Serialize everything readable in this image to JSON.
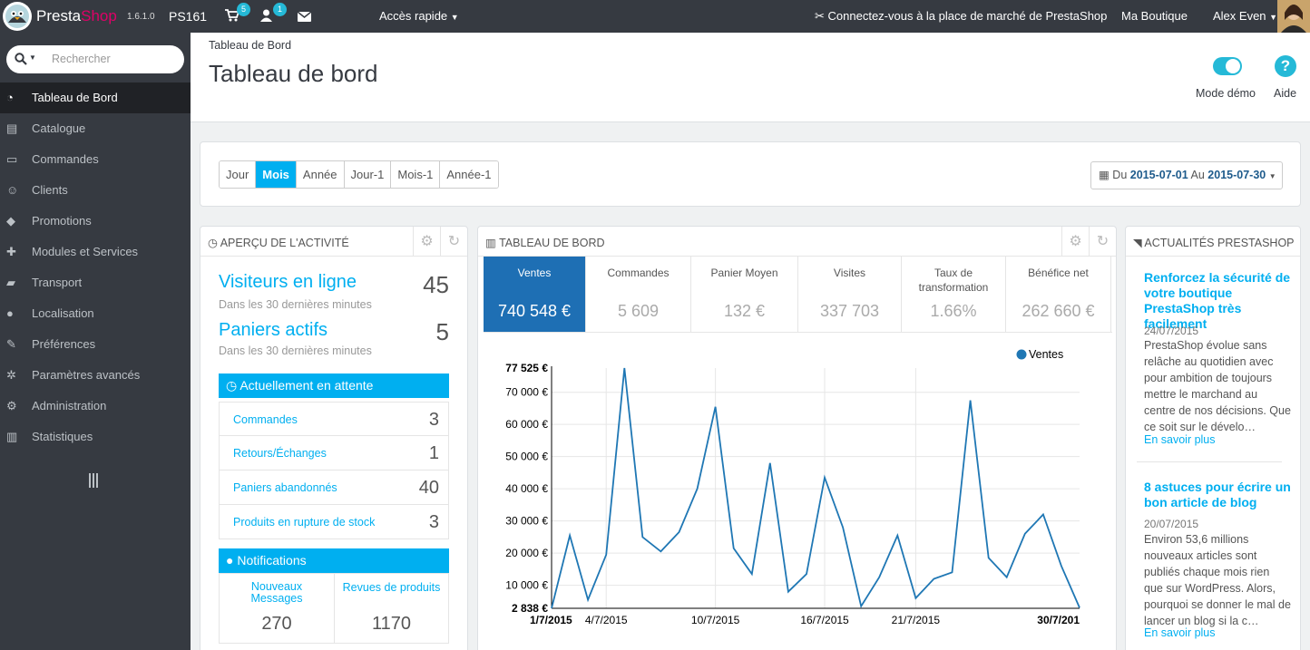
{
  "topbar": {
    "brand_a": "Presta",
    "brand_b": "Shop",
    "version": "1.6.1.0",
    "shop_code": "PS161",
    "cart_badge": "5",
    "customer_badge": "1",
    "quick_access": "Accès rapide",
    "marketplace": "Connectez-vous à la place de marché de PrestaShop",
    "my_shop": "Ma Boutique",
    "user": "Alex Even"
  },
  "sidebar": {
    "search_placeholder": "Rechercher",
    "items": [
      {
        "label": "Tableau de Bord",
        "icon": "dashboard-icon"
      },
      {
        "label": "Catalogue",
        "icon": "book-icon"
      },
      {
        "label": "Commandes",
        "icon": "credit-card-icon"
      },
      {
        "label": "Clients",
        "icon": "users-icon"
      },
      {
        "label": "Promotions",
        "icon": "tags-icon"
      },
      {
        "label": "Modules et Services",
        "icon": "puzzle-icon"
      },
      {
        "label": "Transport",
        "icon": "truck-icon"
      },
      {
        "label": "Localisation",
        "icon": "globe-icon"
      },
      {
        "label": "Préférences",
        "icon": "wrench-icon"
      },
      {
        "label": "Paramètres avancés",
        "icon": "cogs-icon"
      },
      {
        "label": "Administration",
        "icon": "gear-icon"
      },
      {
        "label": "Statistiques",
        "icon": "bar-chart-icon"
      }
    ]
  },
  "header": {
    "breadcrumb": "Tableau de Bord",
    "title": "Tableau de bord",
    "demo_label": "Mode démo",
    "help_label": "Aide"
  },
  "period": {
    "buttons": [
      "Jour",
      "Mois",
      "Année",
      "Jour-1",
      "Mois-1",
      "Année-1"
    ],
    "active": "Mois",
    "range_du": "Du",
    "range_from": "2015-07-01",
    "range_au": "Au",
    "range_to": "2015-07-30"
  },
  "activity": {
    "title": "APERÇU DE L'ACTIVITÉ",
    "visitors_label": "Visiteurs en ligne",
    "visitors_value": "45",
    "visitors_sub": "Dans les 30 dernières minutes",
    "carts_label": "Paniers actifs",
    "carts_value": "5",
    "carts_sub": "Dans les 30 dernières minutes",
    "pending_title": "Actuellement en attente",
    "pending": [
      {
        "label": "Commandes",
        "value": "3"
      },
      {
        "label": "Retours/Échanges",
        "value": "1"
      },
      {
        "label": "Paniers abandonnés",
        "value": "40"
      },
      {
        "label": "Produits en rupture de stock",
        "value": "3"
      }
    ],
    "notif_title": "Notifications",
    "notif_messages_label": "Nouveaux Messages",
    "notif_messages_value": "270",
    "notif_reviews_label": "Revues de produits",
    "notif_reviews_value": "1170"
  },
  "dashboard": {
    "title": "TABLEAU DE BORD",
    "kpis": [
      {
        "label": "Ventes",
        "value": "740 548 €"
      },
      {
        "label": "Commandes",
        "value": "5 609"
      },
      {
        "label": "Panier Moyen",
        "value": "132 €"
      },
      {
        "label": "Visites",
        "value": "337 703"
      },
      {
        "label": "Taux de transformation",
        "value": "1.66%"
      },
      {
        "label": "Bénéfice net",
        "value": "262 660 €"
      }
    ]
  },
  "news": {
    "title": "ACTUALITÉS PRESTASHOP",
    "items": [
      {
        "title": "Renforcez la sécurité de votre boutique PrestaShop très facilement",
        "date": "24/07/2015",
        "text": "PrestaShop évolue sans relâche au quotidien avec pour ambition de toujours mettre le marchand au centre de nos décisions. Que ce soit sur le dévelo…",
        "more": "En savoir plus"
      },
      {
        "title": "8 astuces pour écrire un bon article de blog",
        "date": "20/07/2015",
        "text": "Environ 53,6 millions nouveaux articles sont publiés chaque mois rien que sur WordPress. Alors, pourquoi se donner le mal de lancer un blog si la c…",
        "more": "En savoir plus"
      }
    ]
  },
  "colors": {
    "topbar": "#363a41",
    "accent": "#00aff0",
    "kpi_selected": "#1e6fb4",
    "line": "#1f77b4"
  },
  "chart_data": {
    "type": "line",
    "series": [
      {
        "name": "Ventes",
        "x": [
          "1/7/2015",
          "2/7/2015",
          "3/7/2015",
          "4/7/2015",
          "5/7/2015",
          "6/7/2015",
          "7/7/2015",
          "8/7/2015",
          "9/7/2015",
          "10/7/2015",
          "11/7/2015",
          "12/7/2015",
          "13/7/2015",
          "14/7/2015",
          "15/7/2015",
          "16/7/2015",
          "17/7/2015",
          "18/7/2015",
          "19/7/2015",
          "20/7/2015",
          "21/7/2015",
          "22/7/2015",
          "23/7/2015",
          "24/7/2015",
          "25/7/2015",
          "26/7/2015",
          "27/7/2015",
          "28/7/2015",
          "29/7/2015",
          "30/7/2015"
        ],
        "values": [
          2838,
          25500,
          5500,
          19500,
          77525,
          25000,
          20500,
          26500,
          40000,
          65500,
          21500,
          13500,
          48000,
          8000,
          13500,
          43500,
          28000,
          3500,
          12500,
          25500,
          6000,
          12000,
          14000,
          67500,
          18500,
          12500,
          26000,
          32000,
          16000,
          3000
        ]
      }
    ],
    "y_ticks": [
      "2 838 €",
      "10 000 €",
      "20 000 €",
      "30 000 €",
      "40 000 €",
      "50 000 €",
      "60 000 €",
      "70 000 €",
      "77 525 €"
    ],
    "y_tick_values": [
      2838,
      10000,
      20000,
      30000,
      40000,
      50000,
      60000,
      70000,
      77525
    ],
    "x_ticks": [
      "1/7/2015",
      "4/7/2015",
      "10/7/2015",
      "16/7/2015",
      "21/7/2015",
      "30/7/201"
    ],
    "x_tick_index": [
      0,
      3,
      9,
      15,
      20,
      29
    ],
    "ylim": [
      2838,
      77525
    ],
    "legend": "top-right",
    "grid": true
  }
}
